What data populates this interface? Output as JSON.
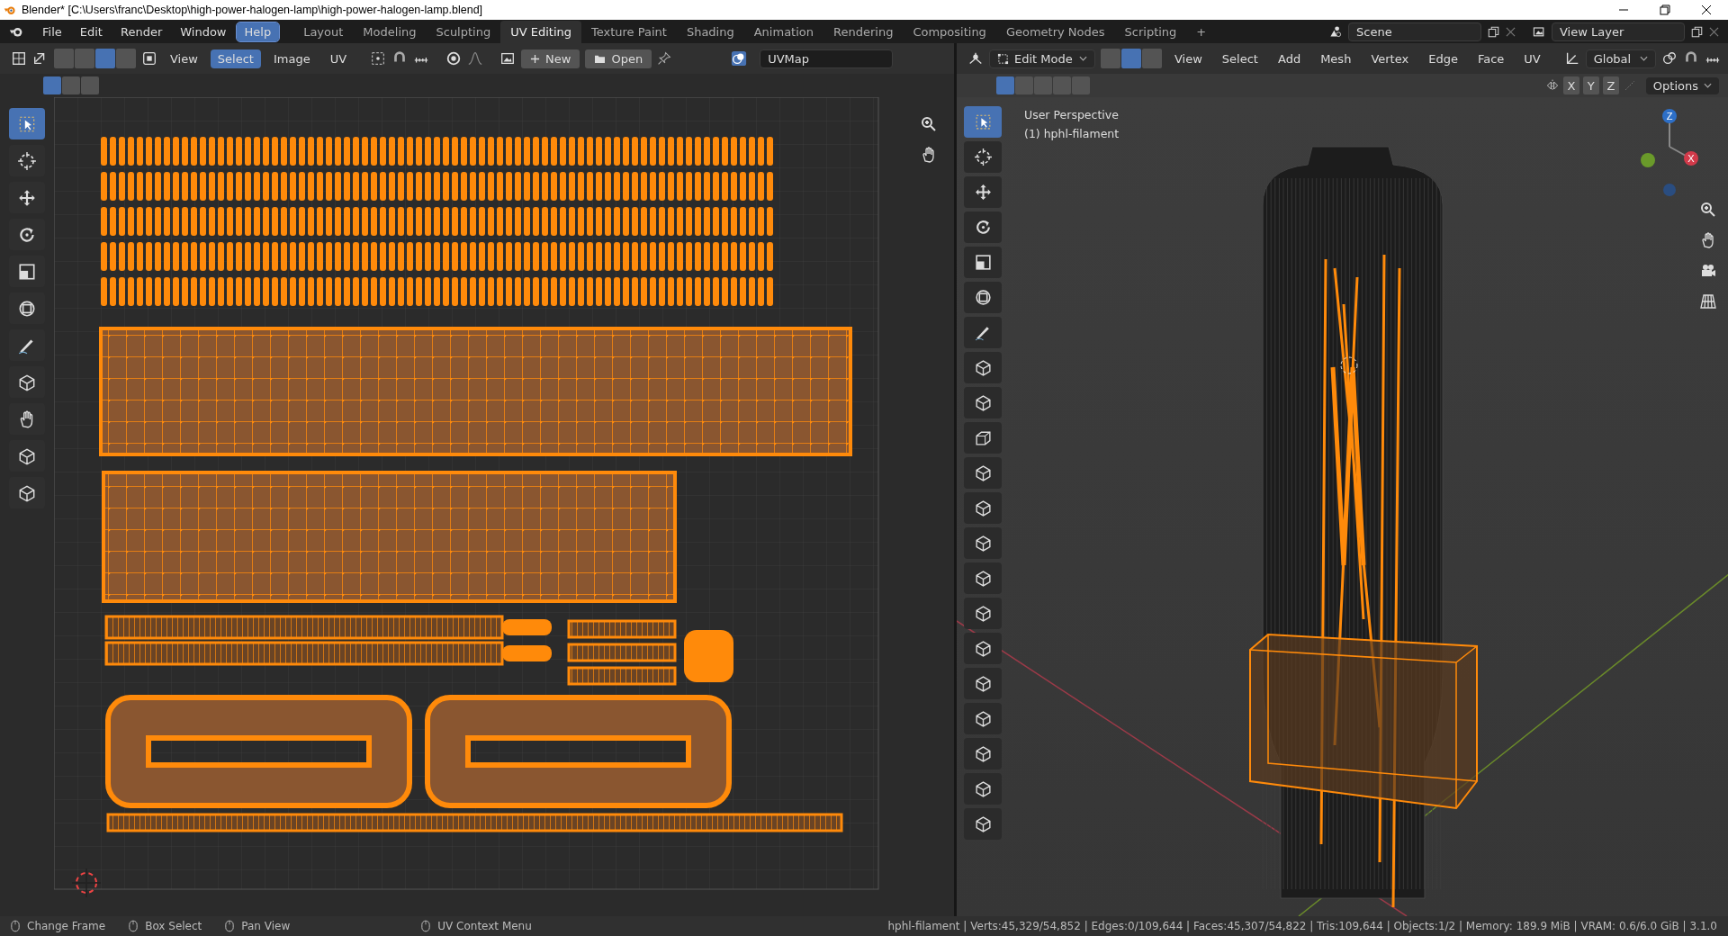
{
  "window": {
    "title": "Blender* [C:\\Users\\franc\\Desktop\\high-power-halogen-lamp\\high-power-halogen-lamp.blend]"
  },
  "menus": [
    {
      "label": "File",
      "selected": false
    },
    {
      "label": "Edit",
      "selected": false
    },
    {
      "label": "Render",
      "selected": false
    },
    {
      "label": "Window",
      "selected": false
    },
    {
      "label": "Help",
      "selected": true
    }
  ],
  "workspaces": [
    {
      "label": "Layout",
      "selected": false
    },
    {
      "label": "Modeling",
      "selected": false
    },
    {
      "label": "Sculpting",
      "selected": false
    },
    {
      "label": "UV Editing",
      "selected": true
    },
    {
      "label": "Texture Paint",
      "selected": false
    },
    {
      "label": "Shading",
      "selected": false
    },
    {
      "label": "Animation",
      "selected": false
    },
    {
      "label": "Rendering",
      "selected": false
    },
    {
      "label": "Compositing",
      "selected": false
    },
    {
      "label": "Geometry Nodes",
      "selected": false
    },
    {
      "label": "Scripting",
      "selected": false
    },
    {
      "label": "+",
      "selected": false
    }
  ],
  "scene": {
    "value": "Scene"
  },
  "view_layer": {
    "value": "View Layer"
  },
  "uv_editor": {
    "select_modes": [
      {
        "selected": false
      },
      {
        "selected": false
      },
      {
        "selected": true
      },
      {
        "selected": false
      }
    ],
    "menus": [
      {
        "label": "View",
        "selected": false
      },
      {
        "label": "Select",
        "selected": true
      },
      {
        "label": "Image",
        "selected": false
      },
      {
        "label": "UV",
        "selected": false
      }
    ],
    "new_button": "New",
    "open_button": "Open",
    "uv_map": "UVMap",
    "box_modes": [
      {
        "selected": true
      },
      {
        "selected": false
      },
      {
        "selected": false
      }
    ],
    "tools": [
      {
        "kind": "select",
        "selected": true
      },
      {
        "kind": "cursor",
        "selected": false
      },
      {
        "kind": "move",
        "selected": false
      },
      {
        "kind": "rotate",
        "selected": false
      },
      {
        "kind": "scale",
        "selected": false
      },
      {
        "kind": "transform",
        "selected": false
      },
      {
        "kind": "annotate",
        "selected": false
      },
      {
        "kind": "rip",
        "selected": false
      },
      {
        "kind": "grab",
        "selected": false
      },
      {
        "kind": "relax",
        "selected": false
      },
      {
        "kind": "pinch",
        "selected": false
      }
    ]
  },
  "viewport": {
    "select_modes": [
      {
        "selected": false
      },
      {
        "selected": true
      },
      {
        "selected": false
      }
    ],
    "mode": "Edit Mode",
    "menus": [
      "View",
      "Select",
      "Add",
      "Mesh",
      "Vertex",
      "Edge",
      "Face",
      "UV"
    ],
    "orientation": "Global",
    "box_modes": [
      {
        "selected": true
      },
      {
        "selected": false
      },
      {
        "selected": false
      },
      {
        "selected": false
      },
      {
        "selected": false
      }
    ],
    "axes": [
      "X",
      "Y",
      "Z"
    ],
    "options": "Options",
    "view_name": "User Perspective",
    "object_name": "(1) hphl-filament",
    "gizmo_labels": [
      "Z",
      "X"
    ],
    "tools": [
      {
        "kind": "select",
        "selected": true
      },
      {
        "kind": "cursor",
        "selected": false
      },
      {
        "kind": "move",
        "selected": false
      },
      {
        "kind": "rotate",
        "selected": false
      },
      {
        "kind": "scale",
        "selected": false
      },
      {
        "kind": "transform",
        "selected": false
      },
      {
        "kind": "annotate",
        "selected": false
      },
      {
        "kind": "measure",
        "selected": false
      },
      {
        "kind": "add-cube",
        "selected": false
      },
      {
        "kind": "extrude",
        "selected": false
      },
      {
        "kind": "inset",
        "selected": false
      },
      {
        "kind": "bevel",
        "selected": false
      },
      {
        "kind": "loop-cut",
        "selected": false
      },
      {
        "kind": "knife",
        "selected": false
      },
      {
        "kind": "poly-build",
        "selected": false
      },
      {
        "kind": "spin",
        "selected": false
      },
      {
        "kind": "smooth",
        "selected": false
      },
      {
        "kind": "edge-slide",
        "selected": false
      },
      {
        "kind": "shrink",
        "selected": false
      },
      {
        "kind": "shear",
        "selected": false
      },
      {
        "kind": "rip",
        "selected": false
      }
    ]
  },
  "status_bar": {
    "hints": [
      "Change Frame",
      "Box Select",
      "Pan View",
      "UV Context Menu"
    ],
    "stats": "hphl-filament | Verts:45,329/54,852 | Edges:0/109,644 | Faces:45,307/54,822 | Tris:109,644 | Objects:1/2 | Memory: 189.9 MiB | VRAM: 0.6/6.0 GiB | 3.1.0"
  }
}
